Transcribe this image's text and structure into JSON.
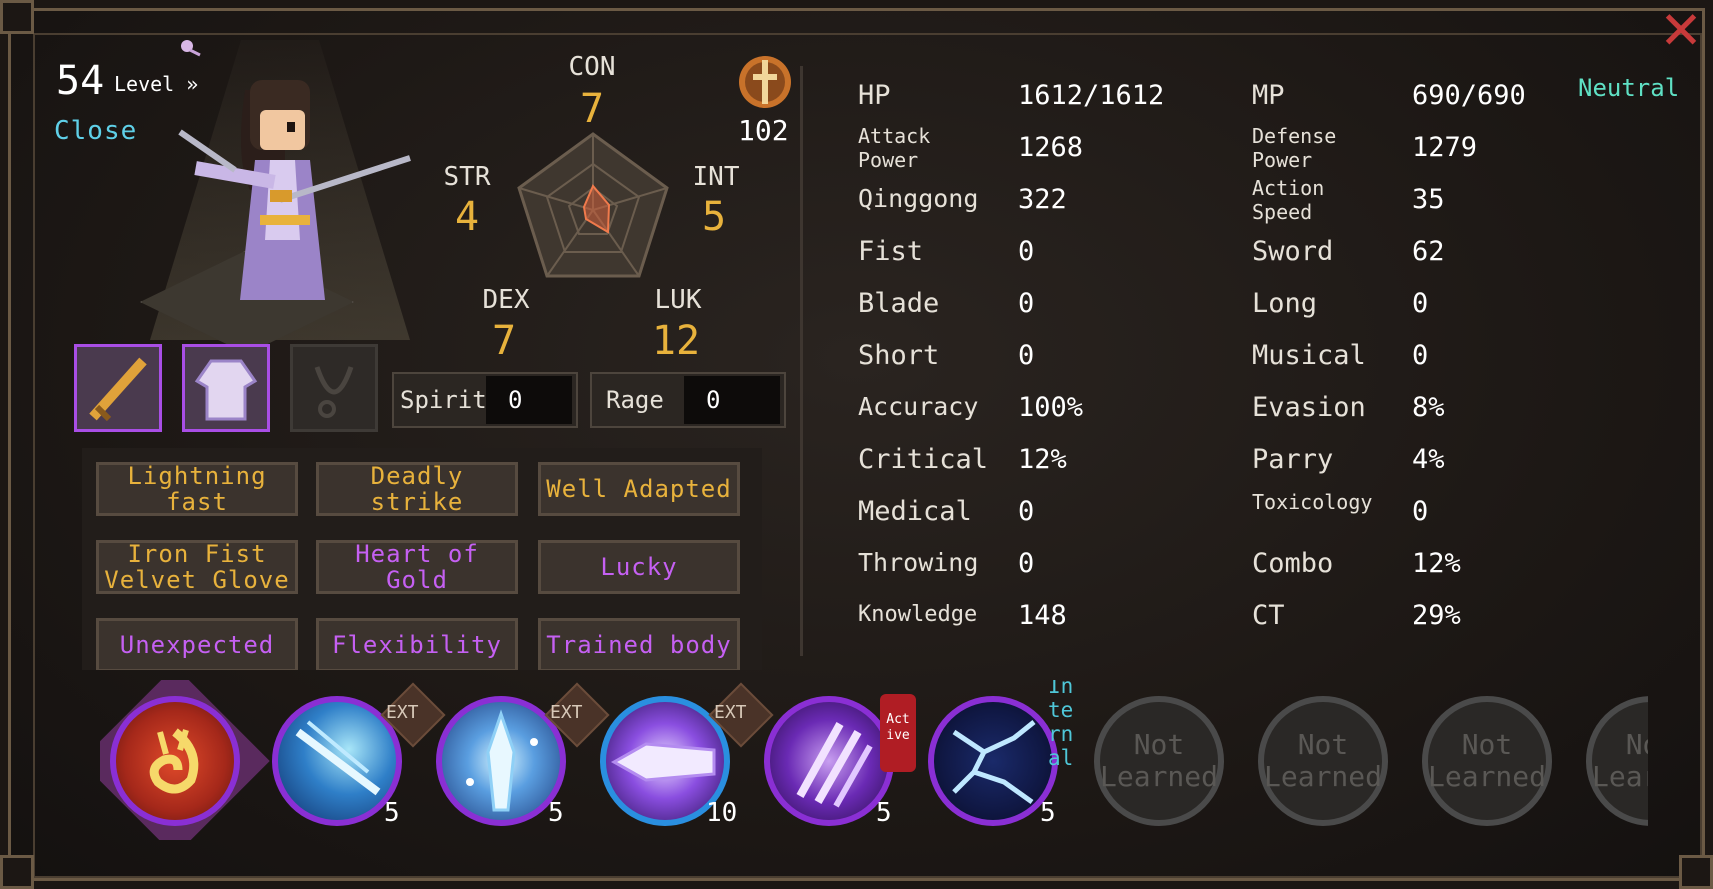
{
  "header": {
    "level_number": "54",
    "level_label": "Level",
    "level_arrow": "»",
    "close_label": "Close",
    "alignment": "Neutral",
    "close_icon": "✕"
  },
  "attributes": {
    "con": {
      "label": "CON",
      "value": "7"
    },
    "str": {
      "label": "STR",
      "value": "4"
    },
    "int": {
      "label": "INT",
      "value": "5"
    },
    "dex": {
      "label": "DEX",
      "value": "7"
    },
    "luk": {
      "label": "LUK",
      "value": "12"
    },
    "emblem_value": "102"
  },
  "pools": {
    "spirit": {
      "label": "Spirit",
      "value": "0"
    },
    "rage": {
      "label": "Rage",
      "value": "0"
    }
  },
  "equipment": [
    {
      "slot": "weapon",
      "icon": "sword-icon",
      "filled": true
    },
    {
      "slot": "armor",
      "icon": "robe-icon",
      "filled": true
    },
    {
      "slot": "accessory",
      "icon": "necklace-icon",
      "filled": false
    }
  ],
  "traits": [
    {
      "label": "Lightning fast",
      "color": "gold"
    },
    {
      "label": "Deadly strike",
      "color": "gold"
    },
    {
      "label": "Well Adapted",
      "color": "gold"
    },
    {
      "label": "Iron Fist Velvet Glove",
      "color": "gold"
    },
    {
      "label": "Heart of Gold",
      "color": "purple"
    },
    {
      "label": "Lucky",
      "color": "purple"
    },
    {
      "label": "Unexpected",
      "color": "purple"
    },
    {
      "label": "Flexibility",
      "color": "purple"
    },
    {
      "label": "Trained body",
      "color": "purple"
    }
  ],
  "stats_left": [
    {
      "label": "HP",
      "value": "1612/1612"
    },
    {
      "label": "Attack Power",
      "value": "1268"
    },
    {
      "label": "Qinggong",
      "value": "322"
    },
    {
      "label": "Fist",
      "value": "0"
    },
    {
      "label": "Blade",
      "value": "0"
    },
    {
      "label": "Short",
      "value": "0"
    },
    {
      "label": "Accuracy",
      "value": "100%"
    },
    {
      "label": "Critical",
      "value": "12%"
    },
    {
      "label": "Medical",
      "value": "0"
    },
    {
      "label": "Throwing",
      "value": "0"
    },
    {
      "label": "Knowledge",
      "value": "148"
    }
  ],
  "stats_right": [
    {
      "label": "MP",
      "value": "690/690"
    },
    {
      "label": "Defense Power",
      "value": "1279"
    },
    {
      "label": "Action Speed",
      "value": "35"
    },
    {
      "label": "Sword",
      "value": "62"
    },
    {
      "label": "Long",
      "value": "0"
    },
    {
      "label": "Musical",
      "value": "0"
    },
    {
      "label": "Evasion",
      "value": "8%"
    },
    {
      "label": "Parry",
      "value": "4%"
    },
    {
      "label": "Toxicology",
      "value": "0"
    },
    {
      "label": "Combo",
      "value": "12%"
    },
    {
      "label": "CT",
      "value": "29%"
    }
  ],
  "skills": [
    {
      "icon": "flame-spiral-icon",
      "level": "",
      "tag": ""
    },
    {
      "icon": "ice-streak-icon",
      "level": "5",
      "tag": "EXT"
    },
    {
      "icon": "ice-crystal-icon",
      "level": "5",
      "tag": "EXT"
    },
    {
      "icon": "purple-blade-icon",
      "level": "10",
      "tag": "EXT"
    },
    {
      "icon": "claw-slash-icon",
      "level": "5",
      "tag": "Act ive"
    },
    {
      "icon": "lightning-crack-icon",
      "level": "5",
      "tag": "In te rn al"
    },
    {
      "icon": "locked-skill-icon",
      "label": "Not Learned"
    },
    {
      "icon": "locked-skill-icon",
      "label": "Not Learned"
    },
    {
      "icon": "locked-skill-icon",
      "label": "Not Learned"
    },
    {
      "icon": "locked-skill-icon",
      "label": "Not Learned"
    }
  ],
  "colors": {
    "accent_gold": "#e8b23c",
    "accent_purple": "#c560f2",
    "accent_cyan": "#5fd0e8",
    "frame": "#6b5a45"
  }
}
